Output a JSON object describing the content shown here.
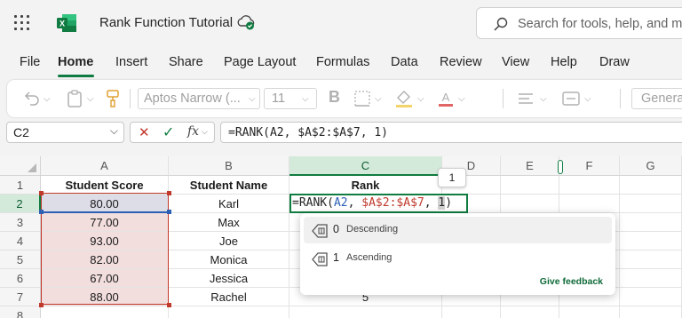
{
  "app": {
    "title": "Rank Function Tutorial",
    "brand_color": "#107c41"
  },
  "search": {
    "placeholder": "Search for tools, help, and m"
  },
  "menu": {
    "tabs": [
      {
        "label": "File"
      },
      {
        "label": "Home",
        "active": true
      },
      {
        "label": "Insert"
      },
      {
        "label": "Share"
      },
      {
        "label": "Page Layout"
      },
      {
        "label": "Formulas"
      },
      {
        "label": "Data"
      },
      {
        "label": "Review"
      },
      {
        "label": "View"
      },
      {
        "label": "Help"
      },
      {
        "label": "Draw"
      }
    ]
  },
  "ribbon": {
    "font_name": "Aptos Narrow (...",
    "font_size": "11",
    "number_format": "Genera",
    "icons": [
      "undo-icon",
      "clipboard-icon",
      "format-painter-icon",
      "bold-icon",
      "borders-icon",
      "fill-color-icon",
      "font-color-icon",
      "align-icon",
      "wrap-icon"
    ]
  },
  "formula_bar": {
    "name_box": "C2",
    "cancel_icon": "✕",
    "enter_icon": "✓",
    "fx_label": "fx",
    "formula": "=RANK(A2, $A$2:$A$7, 1)"
  },
  "grid": {
    "columns": [
      "A",
      "B",
      "C",
      "D",
      "E",
      "F",
      "G"
    ],
    "rows": [
      "1",
      "2",
      "3",
      "4",
      "5",
      "6",
      "7",
      "8"
    ],
    "headers": {
      "a": "Student Score",
      "b": "Student Name",
      "c": "Rank"
    },
    "data": [
      {
        "score": "80.00",
        "name": "Karl"
      },
      {
        "score": "77.00",
        "name": "Max"
      },
      {
        "score": "93.00",
        "name": "Joe"
      },
      {
        "score": "82.00",
        "name": "Monica"
      },
      {
        "score": "67.00",
        "name": "Jessica"
      },
      {
        "score": "88.00",
        "name": "Rachel",
        "rank": "5"
      }
    ],
    "editing": {
      "prefix": "=RANK(",
      "ref1": "A2",
      "sep1": ", ",
      "ref2": "$A$2:$A$7",
      "sep2": ", ",
      "arg": "1",
      "suffix": ")"
    },
    "arg_tooltip": "1"
  },
  "autocomplete": {
    "items": [
      {
        "value": "0",
        "label": "Descending"
      },
      {
        "value": "1",
        "label": "Ascending"
      }
    ],
    "feedback": "Give feedback"
  }
}
